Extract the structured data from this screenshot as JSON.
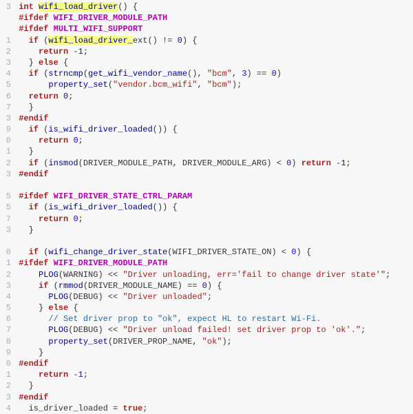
{
  "colors": {
    "highlight": "#f7fd8a"
  },
  "lines": [
    {
      "gutter": "3",
      "tokens": [
        {
          "t": " ",
          "c": ""
        },
        {
          "t": "int",
          "c": "kw"
        },
        {
          "t": " ",
          "c": ""
        },
        {
          "t": "wifi_load_driver",
          "c": "call hl"
        },
        {
          "t": "() {",
          "c": ""
        }
      ]
    },
    {
      "gutter": "",
      "tokens": [
        {
          "t": " #",
          "c": "pp"
        },
        {
          "t": "ifdef",
          "c": "pp"
        },
        {
          "t": " ",
          "c": ""
        },
        {
          "t": "WIFI_DRIVER_MODULE_PATH",
          "c": "dpth"
        }
      ]
    },
    {
      "gutter": "",
      "tokens": [
        {
          "t": " #",
          "c": "pp"
        },
        {
          "t": "ifdef",
          "c": "pp"
        },
        {
          "t": " ",
          "c": ""
        },
        {
          "t": "MULTI_WIFI_SUPPORT",
          "c": "dpth"
        }
      ]
    },
    {
      "gutter": "1",
      "tokens": [
        {
          "t": "   ",
          "c": ""
        },
        {
          "t": "if",
          "c": "kw"
        },
        {
          "t": " (",
          "c": ""
        },
        {
          "t": "wifi_load_driver_",
          "c": "call hl"
        },
        {
          "t": "ext() != ",
          "c": ""
        },
        {
          "t": "0",
          "c": "num"
        },
        {
          "t": ") {",
          "c": ""
        }
      ]
    },
    {
      "gutter": "2",
      "tokens": [
        {
          "t": "     ",
          "c": ""
        },
        {
          "t": "return",
          "c": "kw"
        },
        {
          "t": " -",
          "c": ""
        },
        {
          "t": "1",
          "c": "num"
        },
        {
          "t": ";",
          "c": ""
        }
      ]
    },
    {
      "gutter": "3",
      "tokens": [
        {
          "t": "   } ",
          "c": ""
        },
        {
          "t": "else",
          "c": "kw"
        },
        {
          "t": " {",
          "c": ""
        }
      ]
    },
    {
      "gutter": "4",
      "tokens": [
        {
          "t": "   ",
          "c": ""
        },
        {
          "t": "if",
          "c": "kw"
        },
        {
          "t": " (",
          "c": ""
        },
        {
          "t": "strncmp",
          "c": "call"
        },
        {
          "t": "(",
          "c": ""
        },
        {
          "t": "get_wifi_vendor_name",
          "c": "call"
        },
        {
          "t": "(), ",
          "c": ""
        },
        {
          "t": "\"bcm\"",
          "c": "str"
        },
        {
          "t": ", ",
          "c": ""
        },
        {
          "t": "3",
          "c": "num"
        },
        {
          "t": ") == ",
          "c": ""
        },
        {
          "t": "0",
          "c": "num"
        },
        {
          "t": ")",
          "c": ""
        }
      ]
    },
    {
      "gutter": "5",
      "tokens": [
        {
          "t": "       ",
          "c": ""
        },
        {
          "t": "property_set",
          "c": "call"
        },
        {
          "t": "(",
          "c": ""
        },
        {
          "t": "\"vendor.bcm_wifi\"",
          "c": "str"
        },
        {
          "t": ", ",
          "c": ""
        },
        {
          "t": "\"bcm\"",
          "c": "str"
        },
        {
          "t": ");",
          "c": ""
        }
      ]
    },
    {
      "gutter": "6",
      "tokens": [
        {
          "t": "   ",
          "c": ""
        },
        {
          "t": "return",
          "c": "kw"
        },
        {
          "t": " ",
          "c": ""
        },
        {
          "t": "0",
          "c": "num"
        },
        {
          "t": ";",
          "c": ""
        }
      ]
    },
    {
      "gutter": "7",
      "tokens": [
        {
          "t": "   }",
          "c": ""
        }
      ]
    },
    {
      "gutter": "3",
      "tokens": [
        {
          "t": " #",
          "c": "pp"
        },
        {
          "t": "endif",
          "c": "pp"
        }
      ]
    },
    {
      "gutter": "9",
      "tokens": [
        {
          "t": "   ",
          "c": ""
        },
        {
          "t": "if",
          "c": "kw"
        },
        {
          "t": " (",
          "c": ""
        },
        {
          "t": "is_wifi_driver_loaded",
          "c": "call"
        },
        {
          "t": "()) {",
          "c": ""
        }
      ]
    },
    {
      "gutter": "0",
      "tokens": [
        {
          "t": "     ",
          "c": ""
        },
        {
          "t": "return",
          "c": "kw"
        },
        {
          "t": " ",
          "c": ""
        },
        {
          "t": "0",
          "c": "num"
        },
        {
          "t": ";",
          "c": ""
        }
      ]
    },
    {
      "gutter": "1",
      "tokens": [
        {
          "t": "   }",
          "c": ""
        }
      ]
    },
    {
      "gutter": "2",
      "tokens": [
        {
          "t": "   ",
          "c": ""
        },
        {
          "t": "if",
          "c": "kw"
        },
        {
          "t": " (",
          "c": ""
        },
        {
          "t": "insmod",
          "c": "call"
        },
        {
          "t": "(DRIVER_MODULE_PATH, DRIVER_MODULE_ARG) < ",
          "c": ""
        },
        {
          "t": "0",
          "c": "num"
        },
        {
          "t": ") ",
          "c": ""
        },
        {
          "t": "return",
          "c": "kw"
        },
        {
          "t": " -",
          "c": ""
        },
        {
          "t": "1",
          "c": "num"
        },
        {
          "t": ";",
          "c": ""
        }
      ]
    },
    {
      "gutter": "3",
      "tokens": [
        {
          "t": " #",
          "c": "pp"
        },
        {
          "t": "endif",
          "c": "pp"
        }
      ]
    },
    {
      "gutter": "",
      "tokens": [
        {
          "t": " ",
          "c": ""
        }
      ]
    },
    {
      "gutter": "5",
      "tokens": [
        {
          "t": " #",
          "c": "pp"
        },
        {
          "t": "ifdef",
          "c": "pp"
        },
        {
          "t": " ",
          "c": ""
        },
        {
          "t": "WIFI_DRIVER_STATE_CTRL_PARAM",
          "c": "dpth"
        }
      ]
    },
    {
      "gutter": "5",
      "tokens": [
        {
          "t": "   ",
          "c": ""
        },
        {
          "t": "if",
          "c": "kw"
        },
        {
          "t": " (",
          "c": ""
        },
        {
          "t": "is_wifi_driver_loaded",
          "c": "call"
        },
        {
          "t": "()) {",
          "c": ""
        }
      ]
    },
    {
      "gutter": "7",
      "tokens": [
        {
          "t": "     ",
          "c": ""
        },
        {
          "t": "return",
          "c": "kw"
        },
        {
          "t": " ",
          "c": ""
        },
        {
          "t": "0",
          "c": "num"
        },
        {
          "t": ";",
          "c": ""
        }
      ]
    },
    {
      "gutter": "3",
      "tokens": [
        {
          "t": "   }",
          "c": ""
        }
      ]
    },
    {
      "gutter": "",
      "tokens": [
        {
          "t": " ",
          "c": ""
        }
      ]
    },
    {
      "gutter": "0",
      "tokens": [
        {
          "t": "   ",
          "c": ""
        },
        {
          "t": "if",
          "c": "kw"
        },
        {
          "t": " (",
          "c": ""
        },
        {
          "t": "wifi_change_driver_state",
          "c": "call"
        },
        {
          "t": "(WIFI_DRIVER_STATE_ON) < ",
          "c": ""
        },
        {
          "t": "0",
          "c": "num"
        },
        {
          "t": ") {",
          "c": ""
        }
      ]
    },
    {
      "gutter": "1",
      "tokens": [
        {
          "t": " #",
          "c": "pp"
        },
        {
          "t": "ifdef",
          "c": "pp"
        },
        {
          "t": " ",
          "c": ""
        },
        {
          "t": "WIFI_DRIVER_MODULE_PATH",
          "c": "dpth"
        }
      ]
    },
    {
      "gutter": "2",
      "tokens": [
        {
          "t": "     ",
          "c": ""
        },
        {
          "t": "PLOG",
          "c": "call"
        },
        {
          "t": "(WARNING) << ",
          "c": ""
        },
        {
          "t": "\"Driver unloading, err='fail to change driver state'\"",
          "c": "str"
        },
        {
          "t": ";",
          "c": ""
        }
      ]
    },
    {
      "gutter": "3",
      "tokens": [
        {
          "t": "     ",
          "c": ""
        },
        {
          "t": "if",
          "c": "kw"
        },
        {
          "t": " (",
          "c": ""
        },
        {
          "t": "rmmod",
          "c": "call"
        },
        {
          "t": "(DRIVER_MODULE_NAME) == ",
          "c": ""
        },
        {
          "t": "0",
          "c": "num"
        },
        {
          "t": ") {",
          "c": ""
        }
      ]
    },
    {
      "gutter": "4",
      "tokens": [
        {
          "t": "       ",
          "c": ""
        },
        {
          "t": "PLOG",
          "c": "call"
        },
        {
          "t": "(DEBUG) << ",
          "c": ""
        },
        {
          "t": "\"Driver unloaded\"",
          "c": "str"
        },
        {
          "t": ";",
          "c": ""
        }
      ]
    },
    {
      "gutter": "5",
      "tokens": [
        {
          "t": "     } ",
          "c": ""
        },
        {
          "t": "else",
          "c": "kw"
        },
        {
          "t": " {",
          "c": ""
        }
      ]
    },
    {
      "gutter": "6",
      "tokens": [
        {
          "t": "       ",
          "c": ""
        },
        {
          "t": "// Set driver prop to \"ok\", expect HL to restart Wi-Fi.",
          "c": "cmt"
        }
      ]
    },
    {
      "gutter": "7",
      "tokens": [
        {
          "t": "       ",
          "c": ""
        },
        {
          "t": "PLOG",
          "c": "call"
        },
        {
          "t": "(DEBUG) << ",
          "c": ""
        },
        {
          "t": "\"Driver unload failed! set driver prop to 'ok'.\"",
          "c": "str"
        },
        {
          "t": ";",
          "c": ""
        }
      ]
    },
    {
      "gutter": "8",
      "tokens": [
        {
          "t": "       ",
          "c": ""
        },
        {
          "t": "property_set",
          "c": "call"
        },
        {
          "t": "(DRIVER_PROP_NAME, ",
          "c": ""
        },
        {
          "t": "\"ok\"",
          "c": "str"
        },
        {
          "t": ");",
          "c": ""
        }
      ]
    },
    {
      "gutter": "9",
      "tokens": [
        {
          "t": "     }",
          "c": ""
        }
      ]
    },
    {
      "gutter": "0",
      "tokens": [
        {
          "t": " #",
          "c": "pp"
        },
        {
          "t": "endif",
          "c": "pp"
        }
      ]
    },
    {
      "gutter": "1",
      "tokens": [
        {
          "t": "     ",
          "c": ""
        },
        {
          "t": "return",
          "c": "kw"
        },
        {
          "t": " -",
          "c": ""
        },
        {
          "t": "1",
          "c": "num"
        },
        {
          "t": ";",
          "c": ""
        }
      ]
    },
    {
      "gutter": "2",
      "tokens": [
        {
          "t": "   }",
          "c": ""
        }
      ]
    },
    {
      "gutter": "3",
      "tokens": [
        {
          "t": " #",
          "c": "pp"
        },
        {
          "t": "endif",
          "c": "pp"
        }
      ]
    },
    {
      "gutter": "4",
      "tokens": [
        {
          "t": "   is_driver_loaded = ",
          "c": ""
        },
        {
          "t": "true",
          "c": "kw"
        },
        {
          "t": ";",
          "c": ""
        }
      ]
    }
  ]
}
